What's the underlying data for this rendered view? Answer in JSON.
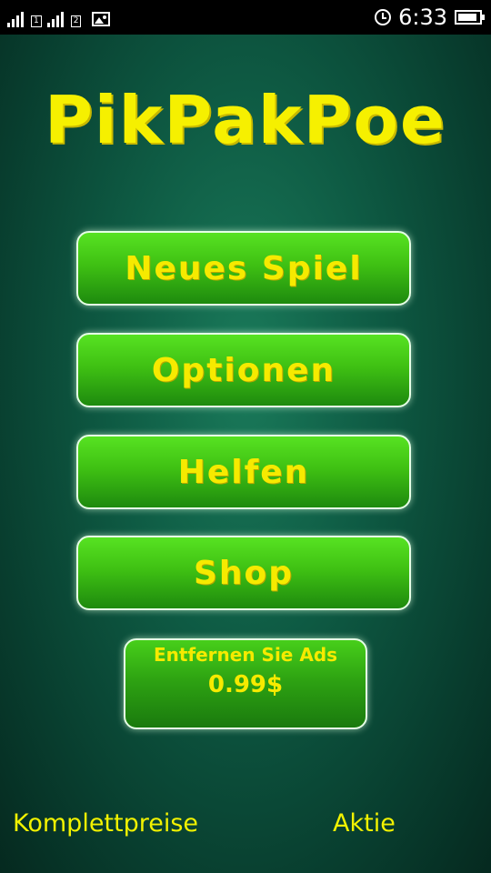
{
  "status_bar": {
    "time": "6:33",
    "sim1_label": "1",
    "sim2_label": "2",
    "battery_level": 0.9
  },
  "game": {
    "title": "PikPakPoe",
    "menu": {
      "new_game": "Neues Spiel",
      "options": "Optionen",
      "help": "Helfen",
      "shop": "Shop"
    },
    "remove_ads": {
      "line1": "Entfernen Sie Ads",
      "price": "0.99$"
    },
    "footer": {
      "prices": "Komplettpreise",
      "share": "Aktie"
    }
  },
  "colors": {
    "text_yellow": "#f6ea00",
    "button_green": "#3fc113",
    "background_green": "#0e5a43"
  }
}
